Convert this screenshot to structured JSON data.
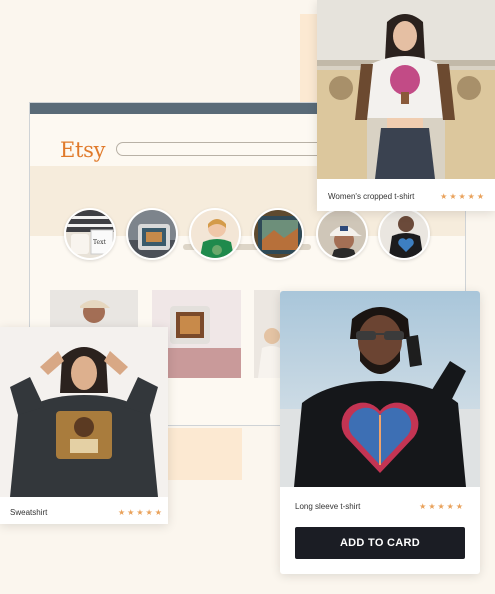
{
  "browser": {
    "logo": "Etsy",
    "search_placeholder": ""
  },
  "circles": [
    {
      "icon": "mug-notebook-image"
    },
    {
      "icon": "pillow-image"
    },
    {
      "icon": "kid-shirt-image"
    },
    {
      "icon": "painting-image"
    },
    {
      "icon": "cap-image"
    },
    {
      "icon": "tshirt-heart-image"
    }
  ],
  "cards": {
    "top_right": {
      "label": "Women's cropped t-shirt",
      "stars": "★★★★★",
      "rating": 5
    },
    "left": {
      "label": "Sweatshirt",
      "stars": "★★★★★",
      "rating": 5
    },
    "right": {
      "label": "Long sleeve t-shirt",
      "stars": "★★★★★",
      "rating": 5,
      "button": "ADD TO CARD"
    }
  },
  "colors": {
    "background": "#fbf6ee",
    "accent": "#e07a2b",
    "star": "#e9a15a",
    "button": "#1b1d24",
    "browser_bar": "#5a6b78"
  }
}
